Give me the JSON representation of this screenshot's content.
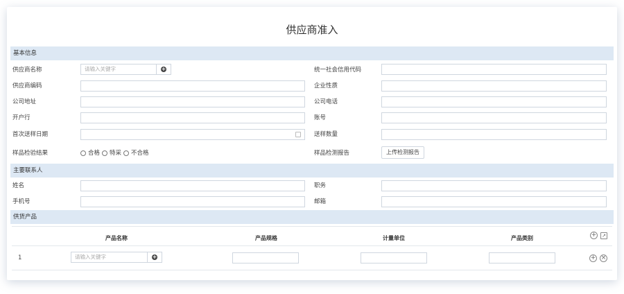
{
  "page_title": "供应商准入",
  "sections": {
    "basic": "基本信息",
    "contact": "主要联系人",
    "products": "供货产品"
  },
  "basic": {
    "supplier_name_label": "供应商名称",
    "supplier_name_placeholder": "请输入关键字",
    "credit_code_label": "统一社会信用代码",
    "supplier_code_label": "供应商编码",
    "company_nature_label": "企业性质",
    "company_address_label": "公司地址",
    "company_phone_label": "公司电话",
    "bank_label": "开户行",
    "account_label": "账号",
    "first_sample_date_label": "首次送样日期",
    "sample_qty_label": "送样数量",
    "inspection_result_label": "样品检验结果",
    "inspection_options": [
      "合格",
      "特采",
      "不合格"
    ],
    "inspection_report_label": "样品检测报告",
    "upload_button": "上传检测报告"
  },
  "contact": {
    "name_label": "姓名",
    "position_label": "职务",
    "mobile_label": "手机号",
    "email_label": "邮箱"
  },
  "products_table": {
    "columns": [
      "产品名称",
      "产品规格",
      "计量单位",
      "产品类别"
    ],
    "rows": [
      {
        "index": "1",
        "name_placeholder": "请输入关键字"
      }
    ]
  },
  "icons": {
    "add": "plus-circle-icon",
    "export": "export-icon",
    "remove": "close-circle-icon",
    "calendar": "calendar-icon"
  }
}
